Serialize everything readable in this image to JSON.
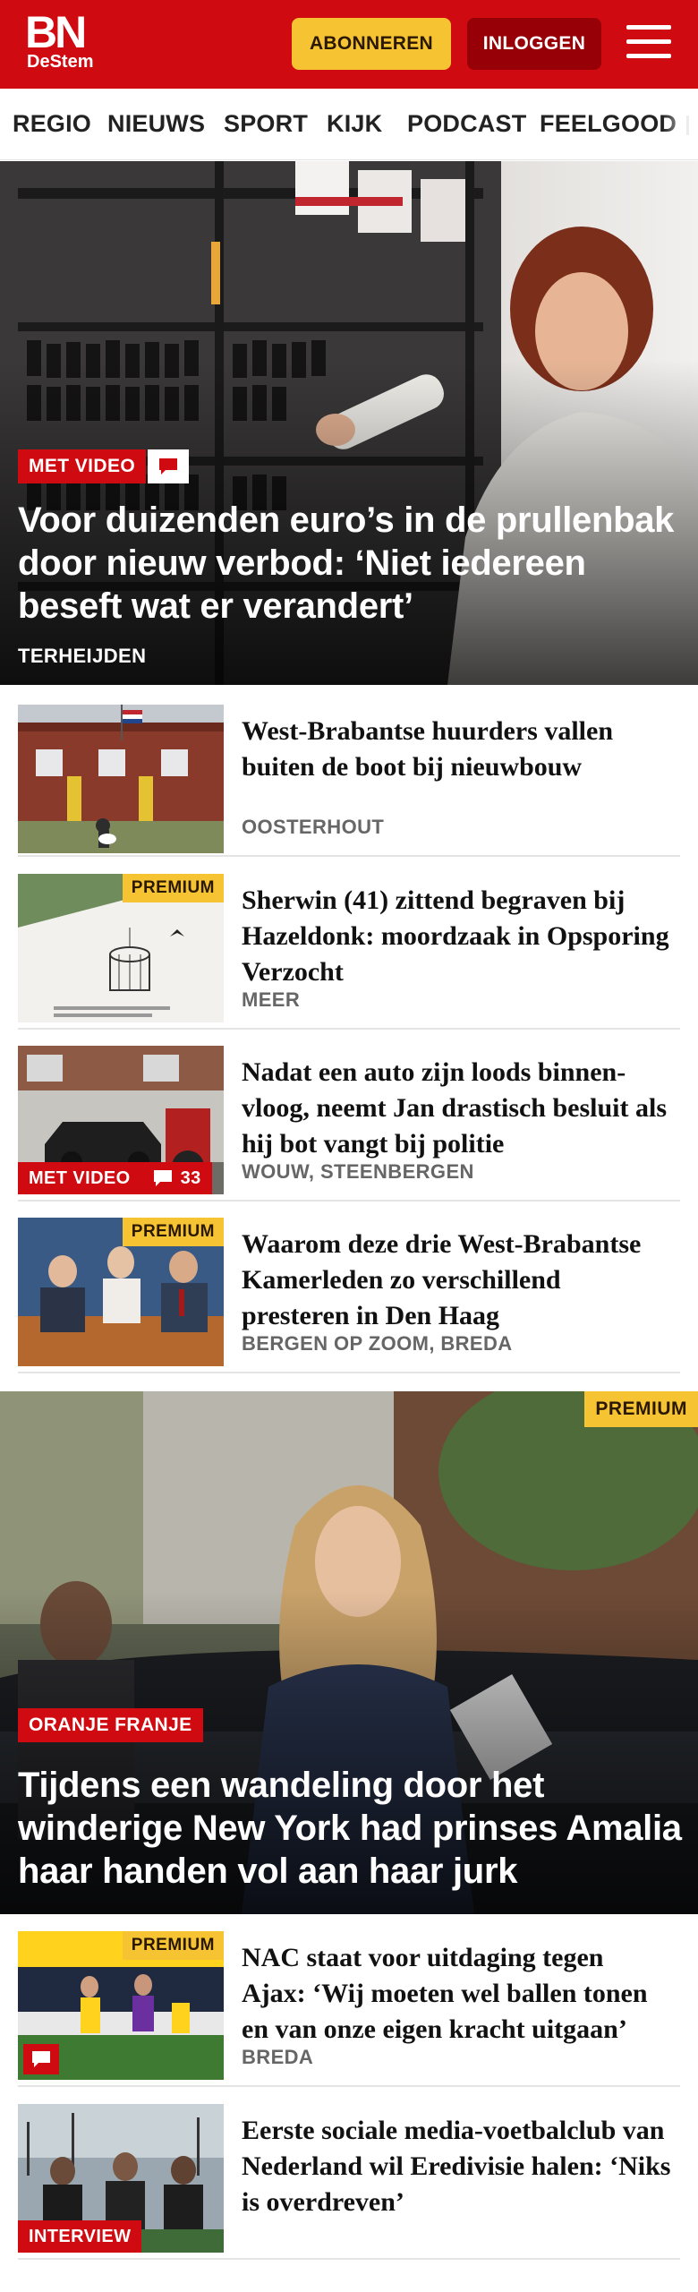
{
  "header": {
    "logo_top": "BN",
    "logo_bottom": "DeStem",
    "subscribe_label": "ABONNEREN",
    "login_label": "INLOGGEN"
  },
  "nav": {
    "items": [
      "REGIO",
      "NIEUWS",
      "SPORT",
      "KIJK",
      "PODCAST",
      "FEELGOOD"
    ]
  },
  "hero1": {
    "tag": "MET VIDEO",
    "title": "Voor duizenden euro’s in de prullenbak door nieuw verbod: ‘Niet iedereen beseft wat er verandert’",
    "location": "TERHEIJDEN"
  },
  "articles": [
    {
      "title": "West-Brabantse huurders vallen buiten de boot bij nieuwbouw",
      "location": "OOSTERHOUT"
    },
    {
      "badge": "PREMIUM",
      "title": "Sherwin (41) zittend begraven bij Hazeldonk: moordzaak in Opsporing Verzocht",
      "location": "MEER"
    },
    {
      "tag": "MET VIDEO",
      "comments": "33",
      "title": "Nadat een auto zijn loods binnen­vloog, neemt Jan drastisch besluit als hij bot vangt bij politie",
      "location": "WOUW, STEENBERGEN"
    },
    {
      "badge": "PREMIUM",
      "title": "Waarom deze drie West-Brabantse Kamerleden zo verschillend presteren in Den Haag",
      "location": "BERGEN OP ZOOM, BREDA"
    }
  ],
  "hero2": {
    "badge": "PREMIUM",
    "tag": "ORANJE FRANJE",
    "title": "Tijdens een wandeling door het winderige New York had prinses Amalia haar handen vol aan haar jurk"
  },
  "articles2": [
    {
      "badge": "PREMIUM",
      "title": "NAC staat voor uitdaging tegen Ajax: ‘Wij moeten wel ballen tonen en van onze eigen kracht uitgaan’",
      "location": "BREDA"
    },
    {
      "tag": "INTERVIEW",
      "title": "Eerste sociale media-voetbal­club van Nederland wil Eredivisie halen: ‘Niks is overdreven’"
    }
  ],
  "colors": {
    "brand_red": "#cf0a10",
    "login_bg": "#980008",
    "premium_yellow": "#f6c432"
  }
}
